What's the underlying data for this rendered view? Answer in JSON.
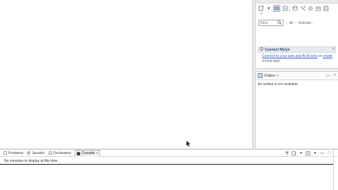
{
  "task_list": {
    "toolbar_icons": [
      "new-task-icon",
      "dropdown-arrow-icon",
      "categorize-icon",
      "scheduled-icon",
      "repository-icon",
      "hide-completed-icon",
      "focus-icon",
      "collapse-icon",
      "view-menu-icon"
    ],
    "subtitle": "▾",
    "find_placeholder": "Find",
    "all_label": "All",
    "activate_label": "Activate...",
    "connect": {
      "title": "Connect Mylyn",
      "body_part1": "Connect to your task and ALM tools",
      "body_link": "create",
      "body_part2": "a local task.",
      "or_label": "or"
    }
  },
  "outline": {
    "tab_label": "Outline",
    "message": "An outline is not available."
  },
  "bottom_panel": {
    "tabs": [
      {
        "label": "Problems",
        "icon": "problems-icon"
      },
      {
        "label": "Javadoc",
        "icon": "javadoc-icon"
      },
      {
        "label": "Declaration",
        "icon": "declaration-icon"
      },
      {
        "label": "Console",
        "icon": "console-icon",
        "active": true
      }
    ],
    "message": "No consoles to display at this time."
  },
  "colors": {
    "link": "#3a5dbd",
    "connect_title": "#2a4d7a",
    "panel_border": "#c9c9c9"
  }
}
